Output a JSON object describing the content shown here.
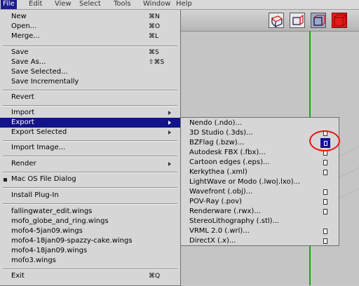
{
  "menubar": {
    "items": [
      "File",
      "Edit",
      "View",
      "Select",
      "Tools",
      "Window",
      "Help"
    ]
  },
  "file_menu": {
    "items": [
      {
        "label": "New",
        "shortcut": "⌘N"
      },
      {
        "label": "Open...",
        "shortcut": "⌘O"
      },
      {
        "label": "Merge...",
        "shortcut": "⌘L"
      },
      {
        "label": "Save",
        "shortcut": "⌘S"
      },
      {
        "label": "Save As...",
        "shortcut": "⇧⌘S"
      },
      {
        "label": "Save Selected...",
        "shortcut": ""
      },
      {
        "label": "Save Incrementally",
        "shortcut": ""
      },
      {
        "label": "Revert",
        "shortcut": ""
      },
      {
        "label": "Import",
        "shortcut": ""
      },
      {
        "label": "Export",
        "shortcut": ""
      },
      {
        "label": "Export Selected",
        "shortcut": ""
      },
      {
        "label": "Import Image...",
        "shortcut": ""
      },
      {
        "label": "Render",
        "shortcut": ""
      },
      {
        "label": "Mac OS File Dialog",
        "shortcut": ""
      },
      {
        "label": "Install Plug-In",
        "shortcut": ""
      },
      {
        "label": "fallingwater_edit.wings",
        "shortcut": ""
      },
      {
        "label": "mofo_globe_and_ring.wings",
        "shortcut": ""
      },
      {
        "label": "mofo4-5jan09.wings",
        "shortcut": ""
      },
      {
        "label": "mofo4-18jan09-spazzy-cake.wings",
        "shortcut": ""
      },
      {
        "label": "mofo4-18jan09.wings",
        "shortcut": ""
      },
      {
        "label": "mofo3.wings",
        "shortcut": ""
      },
      {
        "label": "Exit",
        "shortcut": "⌘Q"
      }
    ]
  },
  "export_submenu": {
    "items": [
      {
        "label": "Nendo (.ndo)..."
      },
      {
        "label": "3D Studio (.3ds)..."
      },
      {
        "label": "BZFlag (.bzw)..."
      },
      {
        "label": "Autodesk FBX (.fbx)..."
      },
      {
        "label": "Cartoon edges (.eps)..."
      },
      {
        "label": "Kerkythea (.xml)"
      },
      {
        "label": "LightWave or Modo (.lwo|.lxo)..."
      },
      {
        "label": "Wavefront (.obj)..."
      },
      {
        "label": "POV-Ray (.pov)"
      },
      {
        "label": "Renderware (.rwx)..."
      },
      {
        "label": "StereoLithography (.stl)..."
      },
      {
        "label": "VRML 2.0 (.wrl)..."
      },
      {
        "label": "DirectX (.x)..."
      }
    ]
  },
  "colors": {
    "highlight": "#13138a",
    "menu_bg": "#d6d6d6",
    "viewport_bg": "#c5c5c5",
    "y_axis": "#1ca21c",
    "annotation": "#ee1111"
  },
  "view_cube_icons": [
    "perspective-cube-icon",
    "side-view-cube-icon",
    "front-view-cube-icon",
    "solid-red-cube-icon"
  ]
}
